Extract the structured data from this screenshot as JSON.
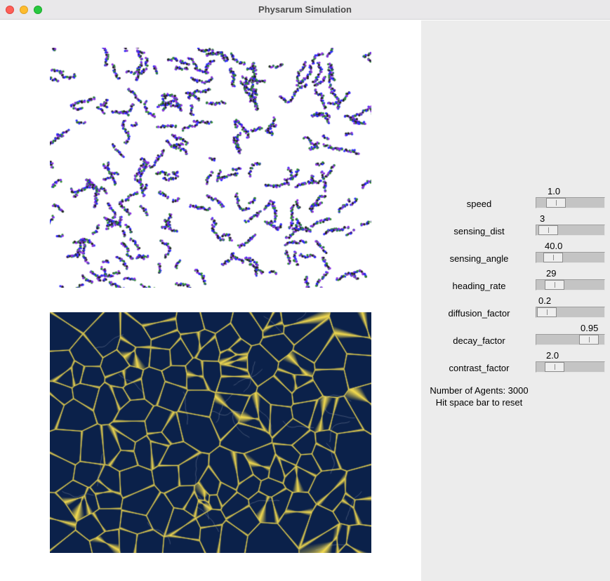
{
  "window": {
    "title": "Physarum Simulation"
  },
  "colors": {
    "trail_background": "#0b214a",
    "trail_highlight": "#f5dc4e",
    "agent_color_1": "#2a2aff",
    "agent_color_2": "#2e8b2e",
    "agent_color_3": "#8a2be2",
    "panel_background": "#ececec"
  },
  "parameters": [
    {
      "name": "speed",
      "value": "1.0",
      "position": 0.2
    },
    {
      "name": "sensing_dist",
      "value": "3",
      "position": 0.05
    },
    {
      "name": "sensing_angle",
      "value": "40.0",
      "position": 0.14
    },
    {
      "name": "heading_rate",
      "value": "29",
      "position": 0.18
    },
    {
      "name": "diffusion_factor",
      "value": "0.2",
      "position": 0.02
    },
    {
      "name": "decay_factor",
      "value": "0.95",
      "position": 0.88
    },
    {
      "name": "contrast_factor",
      "value": "2.0",
      "position": 0.18
    }
  ],
  "status": {
    "agents": "Number of Agents: 3000",
    "reset_hint": "Hit space bar to reset"
  }
}
